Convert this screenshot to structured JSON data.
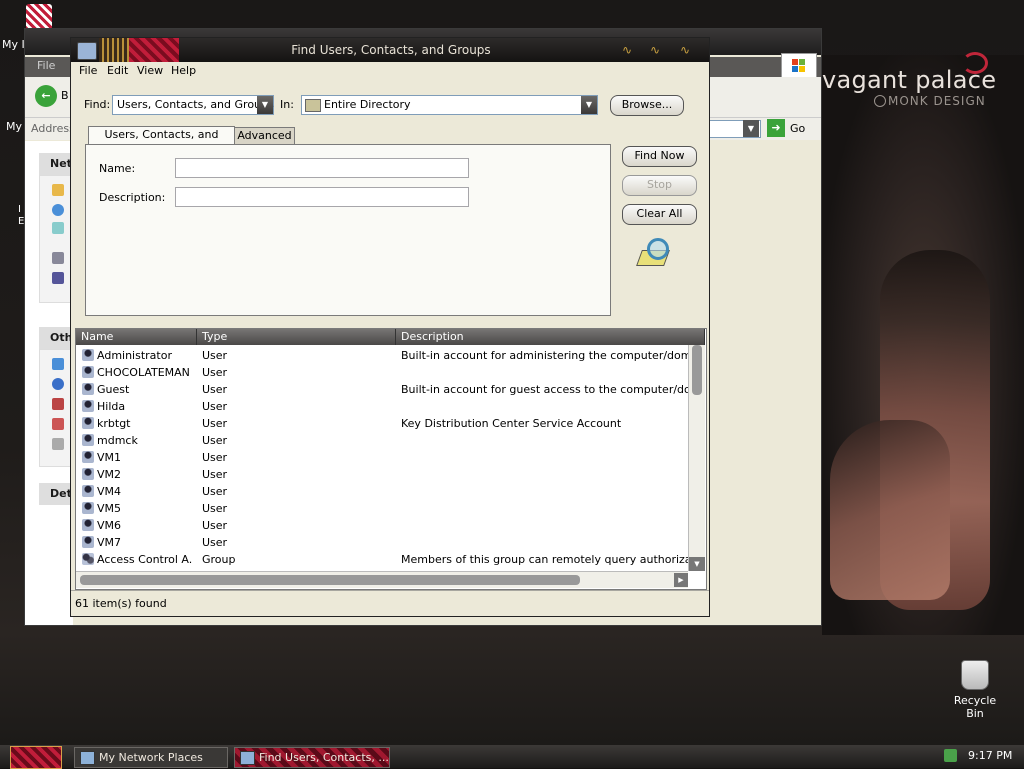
{
  "desktop": {
    "top_icon_label": "My I",
    "side_label_my": "My",
    "brand_title": "vagant palace",
    "brand_subtitle": "MONK DESIGN",
    "recycle_bin_label": "Recycle Bin",
    "partial_letters": [
      "I",
      "E"
    ]
  },
  "background_window": {
    "menu_file": "File",
    "back_label": "B",
    "address_label": "Address",
    "go_label": "Go",
    "pane_network_head": "Netw",
    "pane_other_head": "Oth",
    "pane_details_head": "Det"
  },
  "dialog": {
    "title": "Find Users, Contacts, and Groups",
    "menu": [
      "File",
      "Edit",
      "View",
      "Help"
    ],
    "find_label": "Find:",
    "find_value": "Users, Contacts, and Groups",
    "in_label": "In:",
    "in_value": "Entire Directory",
    "browse_label": "Browse...",
    "tabs": [
      "Users, Contacts, and Groups",
      "Advanced"
    ],
    "name_label": "Name:",
    "name_value": "",
    "description_label": "Description:",
    "description_value": "",
    "find_now_label": "Find Now",
    "stop_label": "Stop",
    "clear_all_label": "Clear All",
    "columns": [
      "Name",
      "Type",
      "Description"
    ],
    "rows": [
      {
        "name": "Administrator",
        "type": "User",
        "description": "Built-in account for administering the computer/domain",
        "icon": "user-icon"
      },
      {
        "name": "CHOCOLATEMAN",
        "type": "User",
        "description": "",
        "icon": "user-icon"
      },
      {
        "name": "Guest",
        "type": "User",
        "description": "Built-in account for guest access to the computer/domain",
        "icon": "user-icon"
      },
      {
        "name": "Hilda",
        "type": "User",
        "description": "",
        "icon": "user-icon"
      },
      {
        "name": "krbtgt",
        "type": "User",
        "description": "Key Distribution Center Service Account",
        "icon": "user-icon"
      },
      {
        "name": "mdmck",
        "type": "User",
        "description": "",
        "icon": "user-icon"
      },
      {
        "name": "VM1",
        "type": "User",
        "description": "",
        "icon": "user-icon"
      },
      {
        "name": "VM2",
        "type": "User",
        "description": "",
        "icon": "user-icon"
      },
      {
        "name": "VM4",
        "type": "User",
        "description": "",
        "icon": "user-icon"
      },
      {
        "name": "VM5",
        "type": "User",
        "description": "",
        "icon": "user-icon"
      },
      {
        "name": "VM6",
        "type": "User",
        "description": "",
        "icon": "user-icon"
      },
      {
        "name": "VM7",
        "type": "User",
        "description": "",
        "icon": "user-icon"
      },
      {
        "name": "Access Control A...",
        "type": "Group",
        "description": "Members of this group can remotely query authorization att",
        "icon": "group-icon"
      }
    ],
    "status": "61 item(s) found"
  },
  "taskbar": {
    "tasks": [
      "My Network Places",
      "Find Users, Contacts, ..."
    ],
    "clock": "9:17 PM"
  },
  "colors": {
    "accent_red": "#c11d3a",
    "dialog_bg": "#ece9d8",
    "title_bg": "#1e1d1d"
  }
}
